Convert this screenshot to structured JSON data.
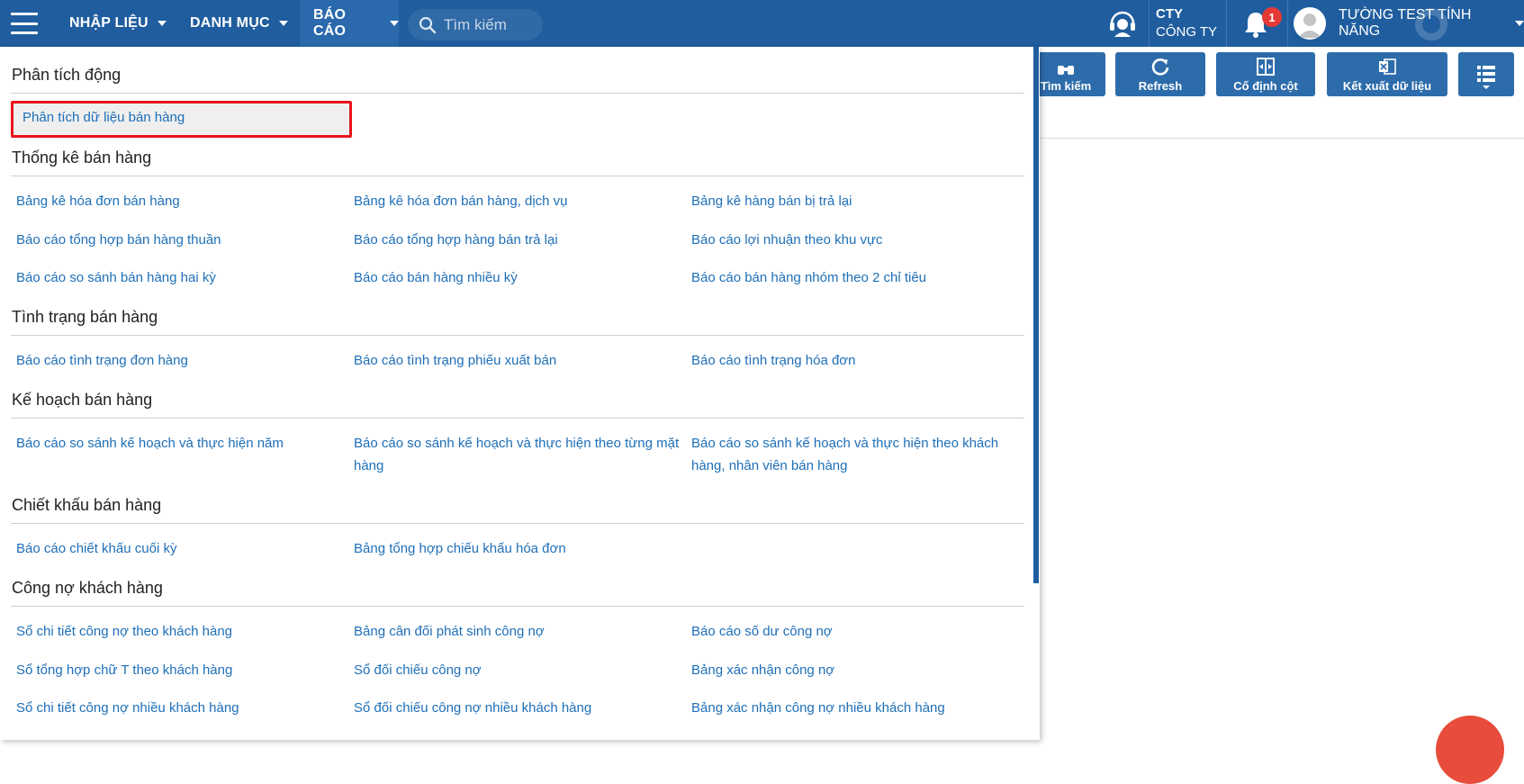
{
  "nav": {
    "items": [
      {
        "label": "NHẬP LIỆU"
      },
      {
        "label": "DANH MỤC"
      },
      {
        "label": "BÁO CÁO"
      }
    ],
    "search_placeholder": "Tìm kiếm",
    "company_line1": "CTY",
    "company_line2": "CÔNG TY",
    "notification_count": "1",
    "username": "TƯỜNG TEST TÍNH NĂNG"
  },
  "toolbar": {
    "buttons": [
      {
        "label": "Tìm kiếm"
      },
      {
        "label": "Refresh"
      },
      {
        "label": "Cố định cột"
      },
      {
        "label": "Kết xuất dữ liệu"
      }
    ]
  },
  "menu": {
    "sections": [
      {
        "title": "Phân tích động",
        "items": [
          "Phân tích dữ liệu bán hàng"
        ]
      },
      {
        "title": "Thống kê bán hàng",
        "items": [
          "Bảng kê hóa đơn bán hàng",
          "Bảng kê hóa đơn bán hàng, dịch vụ",
          "Bảng kê hàng bán bị trả lại",
          "Báo cáo tổng hợp bán hàng thuần",
          "Báo cáo tổng hợp hàng bán trả lại",
          "Báo cáo lợi nhuận theo khu vực",
          "Báo cáo so sánh bán hàng hai kỳ",
          "Báo cáo bán hàng nhiều kỳ",
          "Báo cáo bán hàng nhóm theo 2 chỉ tiêu"
        ]
      },
      {
        "title": "Tình trạng bán hàng",
        "items": [
          "Báo cáo tình trạng đơn hàng",
          "Báo cáo tình trạng phiếu xuất bán",
          "Báo cáo tình trạng hóa đơn"
        ]
      },
      {
        "title": "Kế hoạch bán hàng",
        "items": [
          "Báo cáo so sánh kế hoạch và thực hiện năm",
          "Báo cáo so sánh kế hoạch và thực hiện theo từng mặt hàng",
          "Báo cáo so sánh kế hoạch và thực hiện theo khách hàng, nhân viên bán hàng"
        ]
      },
      {
        "title": "Chiết khấu bán hàng",
        "items": [
          "Báo cáo chiết khấu cuối kỳ",
          "Bảng tổng hợp chiếu khấu hóa đơn"
        ]
      },
      {
        "title": "Công nợ khách hàng",
        "items": [
          "Sổ chi tiết công nợ theo khách hàng",
          "Bảng cân đối phát sinh công nợ",
          "Báo cáo số dư công nợ",
          "Sổ tổng hợp chữ T theo khách hàng",
          "Sổ đối chiếu công nợ",
          "Bảng xác nhận công nợ",
          "Sổ chi tiết công nợ nhiều khách hàng",
          "Sổ đối chiếu công nợ nhiều khách hàng",
          "Bảng xác nhận công nợ nhiều khách hàng"
        ]
      }
    ]
  },
  "colors": {
    "nav_bg": "#1f5d9e",
    "link": "#1e6fb8",
    "highlight_border": "#e8141c",
    "badge": "#e53935"
  }
}
